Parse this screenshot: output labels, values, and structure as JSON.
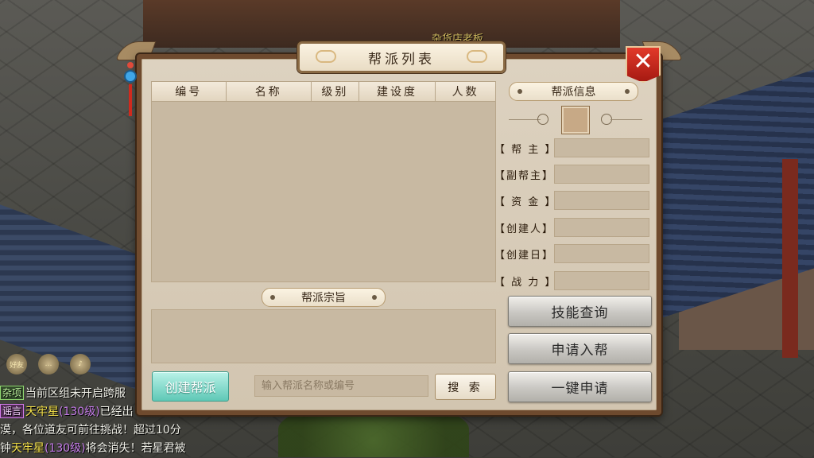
{
  "background": {
    "shop_sign": "杂货店老板"
  },
  "dialog": {
    "title": "帮派列表",
    "close_label": "✕"
  },
  "table": {
    "columns": [
      "编号",
      "名称",
      "级别",
      "建设度",
      "人数"
    ],
    "rows": []
  },
  "info": {
    "header": "帮派信息",
    "fields": [
      {
        "label": "【 帮 主 】",
        "value": ""
      },
      {
        "label": "【副帮主】",
        "value": ""
      },
      {
        "label": "【 资 金 】",
        "value": ""
      },
      {
        "label": "【创建人】",
        "value": ""
      },
      {
        "label": "【创建日】",
        "value": ""
      },
      {
        "label": "【 战 力 】",
        "value": ""
      }
    ]
  },
  "purpose": {
    "header": "帮派宗旨",
    "text": ""
  },
  "actions": {
    "skills_label": "技能查询",
    "apply_label": "申请入帮",
    "quick_apply_label": "一键申请",
    "create_label": "创建帮派",
    "search_placeholder": "输入帮派名称或编号",
    "search_label": "搜 索"
  },
  "chat": {
    "icons": [
      "好友",
      "",
      ""
    ],
    "lines": [
      {
        "tag": "杂项",
        "text": "当前区组未开启跨服"
      },
      {
        "tag": "谣言",
        "name": "天牢星",
        "level": "(130级)",
        "text": "已经出"
      },
      {
        "text": "漠，各位道友可前往挑战！超过10分"
      },
      {
        "prefix": "钟",
        "name": "天牢星",
        "level": "(130级)",
        "text": "将会消失！若星君被"
      }
    ]
  },
  "colors": {
    "frame": "#6e4a2e",
    "panel": "#d8ccb8",
    "create_button": "#5fc8b6",
    "close_button": "#c8281c"
  }
}
